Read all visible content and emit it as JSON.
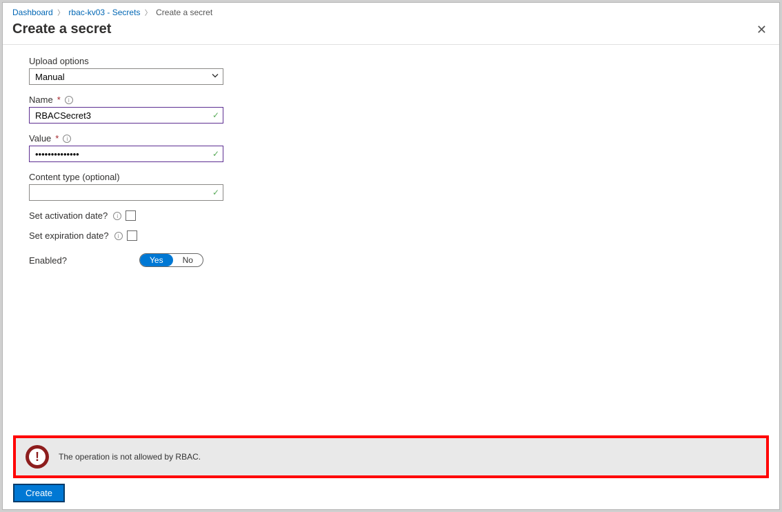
{
  "breadcrumb": {
    "items": [
      {
        "label": "Dashboard",
        "link": true
      },
      {
        "label": "rbac-kv03 - Secrets",
        "link": true
      },
      {
        "label": "Create a secret",
        "link": false
      }
    ]
  },
  "page_title": "Create a secret",
  "form": {
    "upload_options": {
      "label": "Upload options",
      "value": "Manual"
    },
    "name": {
      "label": "Name",
      "required": true,
      "value": "RBACSecret3"
    },
    "value": {
      "label": "Value",
      "required": true,
      "value": "••••••••••••••"
    },
    "content_type": {
      "label": "Content type (optional)",
      "value": ""
    },
    "activation": {
      "label": "Set activation date?",
      "checked": false
    },
    "expiration": {
      "label": "Set expiration date?",
      "checked": false
    },
    "enabled": {
      "label": "Enabled?",
      "yes": "Yes",
      "no": "No",
      "active": "yes"
    }
  },
  "alert": {
    "message": "The operation is not allowed by RBAC."
  },
  "buttons": {
    "create": "Create"
  }
}
